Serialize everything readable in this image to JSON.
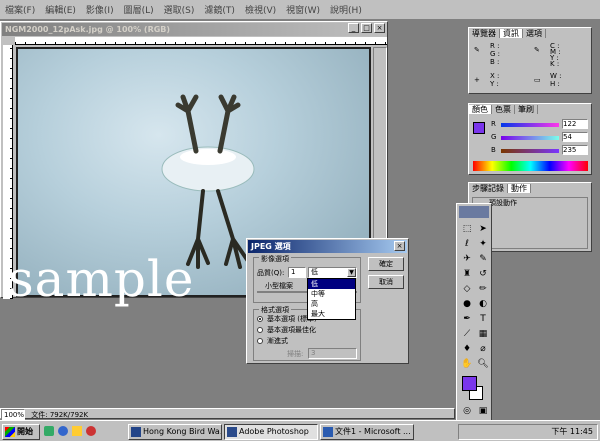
{
  "menubar": {
    "items": [
      "檔案(F)",
      "編輯(E)",
      "影像(I)",
      "圖層(L)",
      "選取(S)",
      "濾鏡(T)",
      "檢視(V)",
      "視窗(W)",
      "說明(H)"
    ]
  },
  "document": {
    "title": "NGM2000_12pAsk.jpg @ 100% (RGB)",
    "watermark_text": "sample"
  },
  "info_panel": {
    "tabs": [
      "導覽器",
      "資訊",
      "選項"
    ],
    "rows": [
      [
        "R :",
        "C :"
      ],
      [
        "G :",
        "M :"
      ],
      [
        "B :",
        "Y :"
      ],
      [
        "",
        "K :"
      ],
      [
        "X :",
        "W :"
      ],
      [
        "Y :",
        "H :"
      ]
    ]
  },
  "color_panel": {
    "tabs": [
      "顏色",
      "色票",
      "筆刷"
    ],
    "channels": [
      {
        "name": "R",
        "value": "122"
      },
      {
        "name": "G",
        "value": "54"
      },
      {
        "name": "B",
        "value": "235"
      }
    ],
    "fg_color": "#7a36eb"
  },
  "history_panel": {
    "tabs": [
      "步驟記錄",
      "動作"
    ],
    "item": "預設動作"
  },
  "toolbox": {
    "fg_color": "#7a36eb",
    "bg_color": "#ffffff"
  },
  "jpeg_dialog": {
    "title": "JPEG 選項",
    "image_options_group": "影像選項",
    "quality_label": "品質(Q):",
    "quality_value": "1",
    "quality_select": "低",
    "small_file_label": "小型檔案",
    "format_group": "格式選項",
    "format_options": [
      "基本選項 (標準)",
      "基本選項最佳化",
      "漸進式"
    ],
    "scans_label": "掃描:",
    "scans_value": "3",
    "ok_button": "確定",
    "cancel_button": "取消",
    "dropdown_items": [
      "低",
      "中等",
      "高",
      "最大"
    ]
  },
  "statusbar": {
    "zoom": "100%",
    "doc_size": "文件: 792K/792K"
  },
  "taskbar": {
    "start": "開始",
    "tasks": [
      "Hong Kong Bird Wa...",
      "Adobe Photoshop",
      "文件1 - Microsoft ..."
    ],
    "clock": "下午 11:45"
  }
}
